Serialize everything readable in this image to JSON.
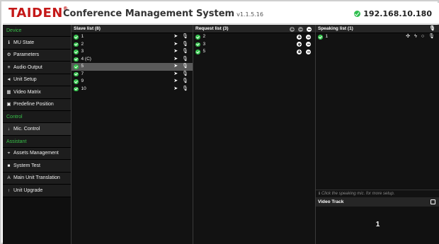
{
  "header": {
    "logo": "TAIDEN",
    "title": "Conference Management System",
    "version": "v1.1.5.16",
    "ip": "192.168.10.180"
  },
  "sidebar": {
    "items": [
      {
        "type": "section",
        "label": "Device"
      },
      {
        "type": "item",
        "label": "MU State",
        "icon": "info-icon",
        "glyph": "ℹ"
      },
      {
        "type": "item",
        "label": "Parameters",
        "icon": "gears-icon",
        "glyph": "⚙"
      },
      {
        "type": "item",
        "label": "Audio Output",
        "icon": "sliders-icon",
        "glyph": "≡"
      },
      {
        "type": "item",
        "label": "Unit Setup",
        "icon": "speaker-icon",
        "glyph": "◄"
      },
      {
        "type": "item",
        "label": "Video Matrix",
        "icon": "grid-icon",
        "glyph": "▦"
      },
      {
        "type": "item",
        "label": "Predefine Position",
        "icon": "camera-icon",
        "glyph": "▣"
      },
      {
        "type": "section",
        "label": "Control"
      },
      {
        "type": "item",
        "label": "Mic. Control",
        "icon": "microphone-icon",
        "glyph": "↓",
        "active": true
      },
      {
        "type": "section",
        "label": "Assistant"
      },
      {
        "type": "item",
        "label": "Assets Management",
        "icon": "location-icon",
        "glyph": "⌖"
      },
      {
        "type": "item",
        "label": "System Test",
        "icon": "test-icon",
        "glyph": "■"
      },
      {
        "type": "item",
        "label": "Main Unit Translation",
        "icon": "translate-icon",
        "glyph": "A"
      },
      {
        "type": "item",
        "label": "Unit Upgrade",
        "icon": "upload-icon",
        "glyph": "↑"
      }
    ]
  },
  "slave_list": {
    "title": "Slave list (8)",
    "rows": [
      {
        "label": "1"
      },
      {
        "label": "2"
      },
      {
        "label": "3"
      },
      {
        "label": "4 (C)"
      },
      {
        "label": "5",
        "selected": true
      },
      {
        "label": "7"
      },
      {
        "label": "9"
      },
      {
        "label": "10"
      }
    ]
  },
  "request_list": {
    "title": "Request list (3)",
    "rows": [
      {
        "label": "2"
      },
      {
        "label": "3"
      },
      {
        "label": "5"
      }
    ]
  },
  "speaking_list": {
    "title": "Speaking list (1)",
    "rows": [
      {
        "label": "1"
      }
    ],
    "hint": "Click the speaking mic. for more setup.",
    "video_track_title": "Video Track",
    "video_track_value": "1"
  },
  "colors": {
    "logo_red": "#c41818",
    "accent_green": "#34c24c",
    "panel_bg": "#121212",
    "selected_row": "#5a5a5a"
  }
}
